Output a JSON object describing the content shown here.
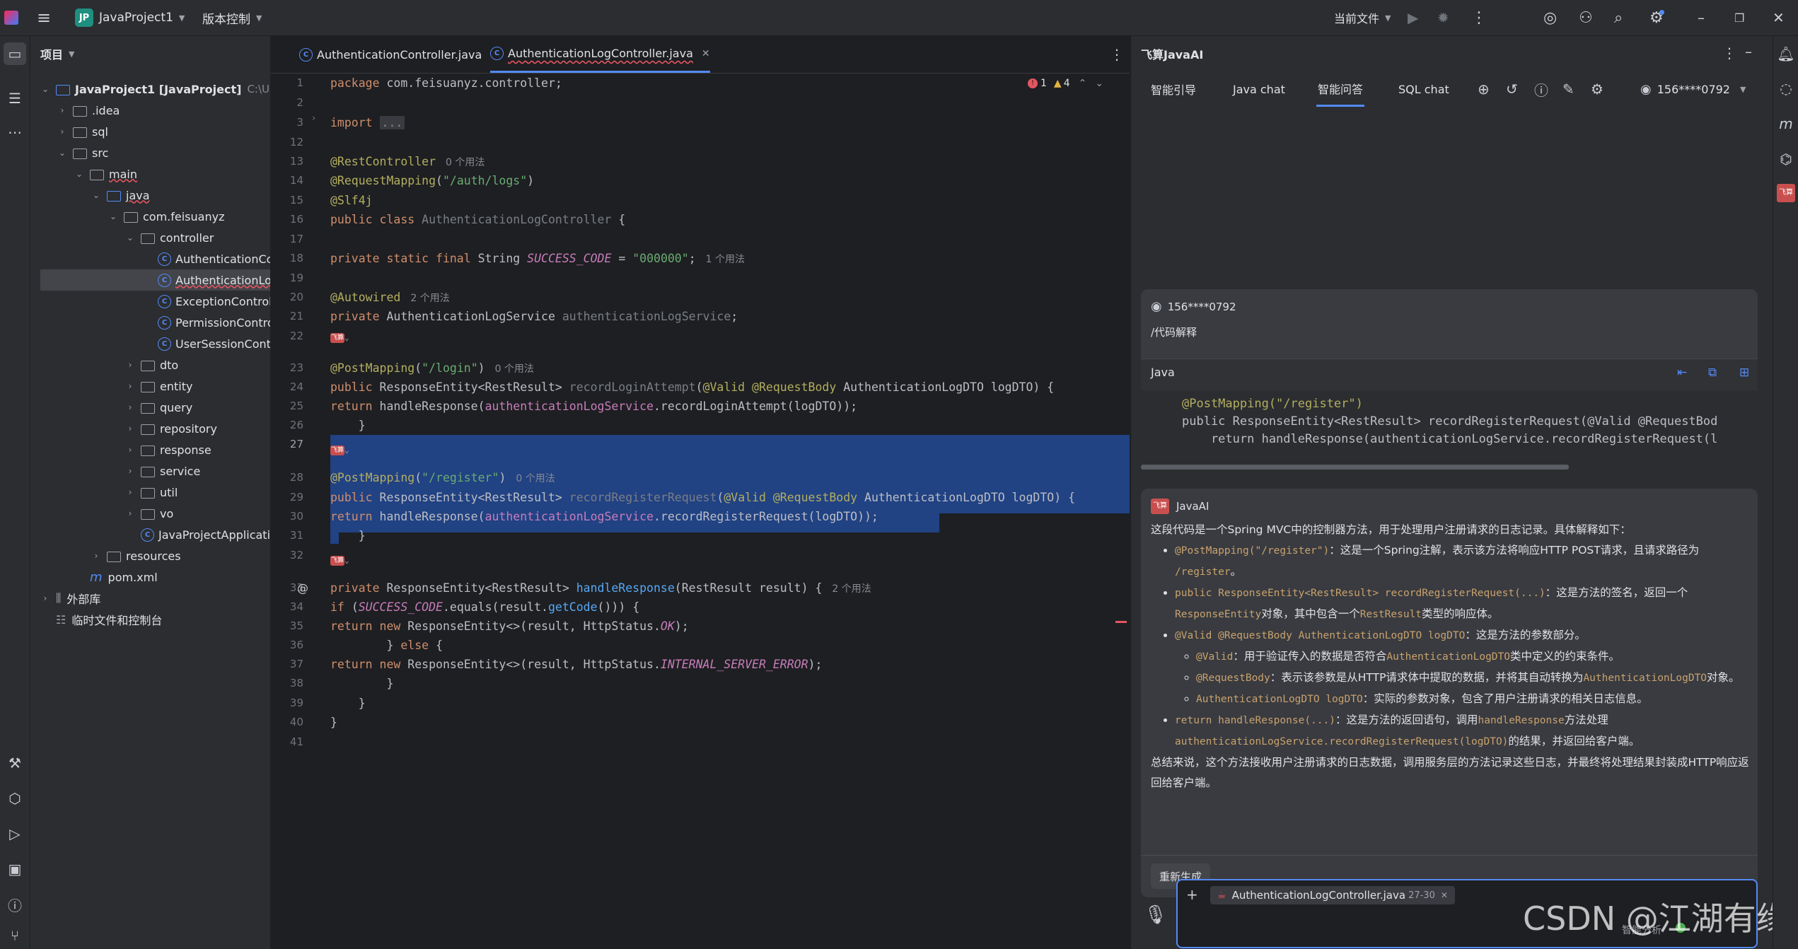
{
  "titlebar": {
    "project_badge": "JP",
    "project_name": "JavaProject1",
    "vcs_label": "版本控制",
    "run_config": "当前文件"
  },
  "project_panel": {
    "title": "项目",
    "tree": [
      {
        "label": "JavaProject1 [JavaProject]",
        "suffix": "C:\\Users\\a",
        "type": "module",
        "depth": 0,
        "open": true
      },
      {
        "label": ".idea",
        "type": "folder",
        "depth": 1,
        "open": false
      },
      {
        "label": "sql",
        "type": "folder",
        "depth": 1,
        "open": false
      },
      {
        "label": "src",
        "type": "folder",
        "depth": 1,
        "open": true
      },
      {
        "label": "main",
        "type": "folder",
        "depth": 2,
        "open": true
      },
      {
        "label": "java",
        "type": "folder-blue",
        "depth": 3,
        "open": true
      },
      {
        "label": "com.feisuanyz",
        "type": "package",
        "depth": 4,
        "open": true
      },
      {
        "label": "controller",
        "type": "package",
        "depth": 5,
        "open": true
      },
      {
        "label": "AuthenticationContr",
        "type": "class",
        "depth": 6
      },
      {
        "label": "AuthenticationLogC",
        "type": "class",
        "depth": 6,
        "selected": true
      },
      {
        "label": "ExceptionControll",
        "type": "class",
        "depth": 6
      },
      {
        "label": "PermissionContro",
        "type": "class",
        "depth": 6
      },
      {
        "label": "UserSessionContr",
        "type": "class",
        "depth": 6
      },
      {
        "label": "dto",
        "type": "package",
        "depth": 5,
        "open": false
      },
      {
        "label": "entity",
        "type": "package",
        "depth": 5,
        "open": false
      },
      {
        "label": "query",
        "type": "package",
        "depth": 5,
        "open": false
      },
      {
        "label": "repository",
        "type": "package",
        "depth": 5,
        "open": false
      },
      {
        "label": "response",
        "type": "package",
        "depth": 5,
        "open": false
      },
      {
        "label": "service",
        "type": "package",
        "depth": 5,
        "open": false
      },
      {
        "label": "util",
        "type": "package",
        "depth": 5,
        "open": false
      },
      {
        "label": "vo",
        "type": "package",
        "depth": 5,
        "open": false
      },
      {
        "label": "JavaProjectApplicatio",
        "type": "class",
        "depth": 5
      },
      {
        "label": "resources",
        "type": "folder",
        "depth": 3,
        "open": false
      },
      {
        "label": "pom.xml",
        "type": "maven",
        "depth": 2
      },
      {
        "label": "外部库",
        "type": "lib",
        "depth": 0,
        "open": false
      },
      {
        "label": "临时文件和控制台",
        "type": "scratch",
        "depth": 0
      }
    ]
  },
  "editor": {
    "tabs": [
      {
        "label": "AuthenticationController.java",
        "active": false
      },
      {
        "label": "AuthenticationLogController.java",
        "active": true
      }
    ],
    "inspection": {
      "errors": "1",
      "warnings": "4"
    },
    "usage_hints": {
      "h0": "0 个用法",
      "h1": "1 个用法",
      "h2": "2 个用法",
      "h3": "0 个用法",
      "h4": "0 个用法",
      "h5": "2 个用法"
    },
    "line_numbers": [
      "1",
      "2",
      "3",
      "12",
      "13",
      "14",
      "15",
      "16",
      "17",
      "18",
      "19",
      "20",
      "21",
      "22",
      "23",
      "24",
      "25",
      "26",
      "27",
      "28",
      "29",
      "30",
      "31",
      "32",
      "33",
      "34",
      "35",
      "36",
      "37",
      "38",
      "39",
      "40",
      "41"
    ],
    "code": {
      "package": "com.feisuanyz.controller;",
      "import_fold": "...",
      "mapping_logs": "\"/auth/logs\"",
      "class_name": "AuthenticationLogController",
      "success_value": "\"000000\"",
      "service_field": "authenticationLogService",
      "login_path": "\"/login\"",
      "register_path": "\"/register\""
    }
  },
  "ai_panel": {
    "title": "飞算JavaAI",
    "tabs": [
      "智能引导",
      "Java chat",
      "智能问答",
      "SQL chat"
    ],
    "active_tab": "智能问答",
    "user": "156****0792",
    "user_message": {
      "name": "156****0792",
      "command": "/代码解释",
      "lang": "Java",
      "code_lines": [
        "@PostMapping(\"/register\")",
        "public ResponseEntity<RestResult> recordRegisterRequest(@Valid @RequestBod",
        "    return handleResponse(authenticationLogService.recordRegisterRequest(l"
      ]
    },
    "answer": {
      "name": "JavaAI",
      "intro": "这段代码是一个Spring MVC中的控制器方法，用于处理用户注册请求的日志记录。具体解释如下：",
      "b1_code": "@PostMapping(\"/register\")",
      "b1_text": "：这是一个Spring注解，表示该方法将响应HTTP POST请求，且请求路径为",
      "b1_code2": "/register",
      "b1_tail": "。",
      "b2_code": "public ResponseEntity<RestResult> recordRegisterRequest(...)",
      "b2_text": "：这是方法的签名，返回一个",
      "b2_code2": "ResponseEntity",
      "b2_text2": "对象，其中包含一个",
      "b2_code3": "RestResult",
      "b2_tail": "类型的响应体。",
      "b3_code": "@Valid @RequestBody AuthenticationLogDTO logDTO",
      "b3_text": "：这是方法的参数部分。",
      "s1_code": "@Valid",
      "s1_text": "：用于验证传入的数据是否符合",
      "s1_code2": "AuthenticationLogDTO",
      "s1_tail": "类中定义的约束条件。",
      "s2_code": "@RequestBody",
      "s2_text": "：表示该参数是从HTTP请求体中提取的数据，并将其自动转换为",
      "s2_code2": "AuthenticationLogDTO",
      "s2_tail": "对象。",
      "s3_code": "AuthenticationLogDTO logDTO",
      "s3_text": "：实际的参数对象，包含了用户注册请求的相关日志信息。",
      "b4_code": "return handleResponse(...)",
      "b4_text": "：这是方法的返回语句，调用",
      "b4_code2": "handleResponse",
      "b4_text2": "方法处理",
      "b4_code3": "authenticationLogService.recordRegisterRequest(logDTO)",
      "b4_tail": "的结果，并返回给客户端。",
      "summary": "总结来说，这个方法接收用户注册请求的日志数据，调用服务层的方法记录这些日志，并最终将处理结果封装成HTTP响应返回给客户端。",
      "regenerate": "重新生成"
    },
    "input": {
      "file_chip": "AuthenticationLogController.java",
      "range": "27-30",
      "mode_label": "智能分析"
    },
    "watermark": "CSDN @江湖有缘"
  }
}
